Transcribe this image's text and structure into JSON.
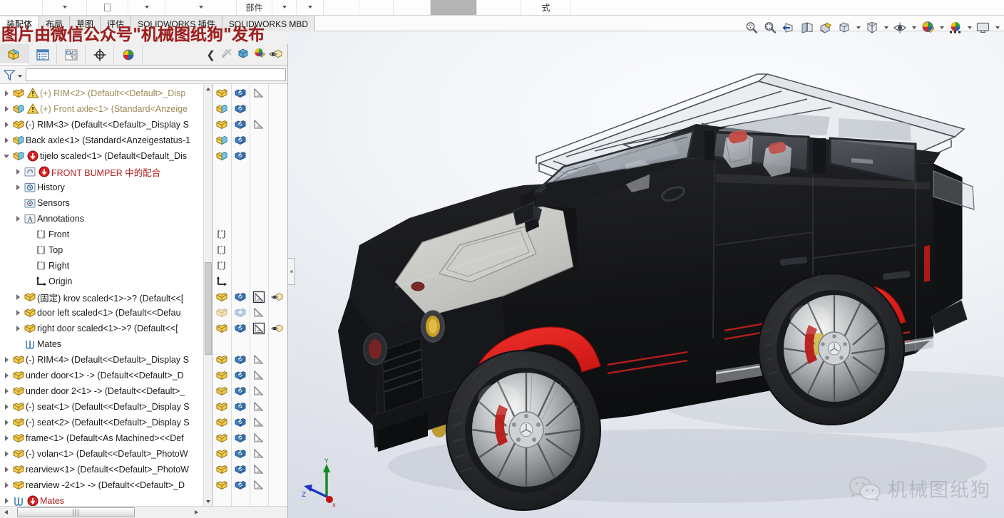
{
  "app": {
    "name": "SOLIDWORKS",
    "document_type_label": "部件",
    "formula_label": "式"
  },
  "ribbon": {
    "tabs": [
      {
        "label": "装配体",
        "active": true
      },
      {
        "label": "布局",
        "active": false
      },
      {
        "label": "草图",
        "active": false
      },
      {
        "label": "评估",
        "active": false
      },
      {
        "label": "SOLIDWORKS 插件",
        "active": false
      },
      {
        "label": "SOLIDWORKS MBD",
        "active": false
      }
    ]
  },
  "watermarks": {
    "top_red_text": "图片由微信公众号\"机械图纸狗\"发布",
    "bottom_right_text": "机械图纸狗",
    "bottom_right_icon": "wechat-icon",
    "top_red_color": "#9c2020",
    "bottom_right_color": "#8d9099"
  },
  "view_toolbar": {
    "items": [
      {
        "name": "zoom-to-fit-icon",
        "caret": false
      },
      {
        "name": "zoom-to-area-icon",
        "caret": false
      },
      {
        "name": "previous-view-icon",
        "caret": false
      },
      {
        "name": "section-view-icon",
        "caret": false
      },
      {
        "name": "view-orientation-icon",
        "caret": false
      },
      {
        "name": "display-style-icon",
        "caret": true
      },
      {
        "name": "hide-show-items-icon",
        "caret": true
      },
      {
        "name": "edit-appearance-icon",
        "caret": true
      },
      {
        "name": "apply-scene-icon",
        "caret": true
      },
      {
        "name": "view-settings-icon",
        "caret": true
      }
    ]
  },
  "manager_tabs": {
    "items": [
      {
        "name": "feature-manager-tab",
        "icon": "assembly-tree-icon",
        "active": true
      },
      {
        "name": "property-manager-tab",
        "icon": "property-list-icon",
        "active": false
      },
      {
        "name": "configuration-manager-tab",
        "icon": "configuration-icon",
        "active": false
      },
      {
        "name": "dimxpert-manager-tab",
        "icon": "dimxpert-target-icon",
        "active": false
      },
      {
        "name": "display-manager-tab",
        "icon": "display-palette-icon",
        "active": false
      }
    ],
    "right_icons": [
      {
        "name": "collapse-panel-chevron-icon"
      },
      {
        "name": "hide-all-types-icon"
      },
      {
        "name": "view-orientation-cube-icon"
      },
      {
        "name": "appearances-icon"
      },
      {
        "name": "display-pane-eye-icon"
      }
    ]
  },
  "filter": {
    "icon": "filter-funnel-icon",
    "value": "",
    "placeholder": ""
  },
  "tree": {
    "rows": [
      {
        "indent": 0,
        "toggle": "right",
        "icon": "component-yellow",
        "warn": true,
        "label": "(+) RIM<2>  (Default<<Default>_Disp",
        "style": "dim"
      },
      {
        "indent": 0,
        "toggle": "right",
        "icon": "component-blue",
        "warn": true,
        "label": "(+) Front axle<1>  (Standard<Anzeige",
        "style": "dim"
      },
      {
        "indent": 0,
        "toggle": "right",
        "icon": "component-yellow",
        "warn": false,
        "label": "(-) RIM<3>  (Default<<Default>_Display S",
        "style": "normal"
      },
      {
        "indent": 0,
        "toggle": "right",
        "icon": "component-blue",
        "warn": false,
        "label": "Back axle<1>  (Standard<Anzeigestatus-1",
        "style": "normal"
      },
      {
        "indent": 0,
        "toggle": "down",
        "icon": "component-blue",
        "err": true,
        "label": "tijelo scaled<1>  (Default<Default_Dis",
        "style": "normal"
      },
      {
        "indent": 1,
        "toggle": "right",
        "icon": "mate-folder-icon",
        "err": true,
        "label": "FRONT BUMPER 中的配合",
        "style": "red"
      },
      {
        "indent": 1,
        "toggle": "right",
        "icon": "history-folder-icon",
        "label": "History",
        "style": "normal"
      },
      {
        "indent": 1,
        "toggle": "none",
        "icon": "sensors-folder-icon",
        "label": "Sensors",
        "style": "normal"
      },
      {
        "indent": 1,
        "toggle": "right",
        "icon": "annotations-folder-icon",
        "label": "Annotations",
        "style": "normal"
      },
      {
        "indent": 2,
        "toggle": "none",
        "icon": "plane-icon",
        "label": "Front",
        "style": "normal"
      },
      {
        "indent": 2,
        "toggle": "none",
        "icon": "plane-icon",
        "label": "Top",
        "style": "normal"
      },
      {
        "indent": 2,
        "toggle": "none",
        "icon": "plane-icon",
        "label": "Right",
        "style": "normal"
      },
      {
        "indent": 2,
        "toggle": "none",
        "icon": "origin-icon",
        "label": "Origin",
        "style": "normal"
      },
      {
        "indent": 1,
        "toggle": "right",
        "icon": "component-yellow",
        "label": "(固定) krov scaled<1>->?  (Default<<[",
        "style": "normal"
      },
      {
        "indent": 1,
        "toggle": "right",
        "icon": "component-yellow",
        "label": "door left scaled<1>  (Default<<Defau",
        "style": "normal"
      },
      {
        "indent": 1,
        "toggle": "right",
        "icon": "component-yellow",
        "label": "right door scaled<1>->?  (Default<<[",
        "style": "normal"
      },
      {
        "indent": 1,
        "toggle": "none",
        "icon": "mates-clip-icon",
        "label": "Mates",
        "style": "normal"
      },
      {
        "indent": 0,
        "toggle": "right",
        "icon": "component-yellow",
        "label": "(-) RIM<4>  (Default<<Default>_Display S",
        "style": "normal"
      },
      {
        "indent": 0,
        "toggle": "right",
        "icon": "component-yellow",
        "label": "under door<1> ->  (Default<<Default>_D",
        "style": "normal"
      },
      {
        "indent": 0,
        "toggle": "right",
        "icon": "component-yellow",
        "label": "under door 2<1> ->  (Default<<Default>_",
        "style": "normal"
      },
      {
        "indent": 0,
        "toggle": "right",
        "icon": "component-yellow",
        "label": "(-) seat<1>  (Default<<Default>_Display S",
        "style": "normal"
      },
      {
        "indent": 0,
        "toggle": "right",
        "icon": "component-yellow",
        "label": "(-) seat<2>  (Default<<Default>_Display S",
        "style": "normal"
      },
      {
        "indent": 0,
        "toggle": "right",
        "icon": "component-yellow",
        "label": "frame<1>  (Default<As Machined><<Def",
        "style": "normal"
      },
      {
        "indent": 0,
        "toggle": "right",
        "icon": "component-yellow",
        "label": "(-) volan<1>  (Default<<Default>_PhotoW",
        "style": "normal"
      },
      {
        "indent": 0,
        "toggle": "right",
        "icon": "component-yellow",
        "label": "rearview<1>  (Default<<Default>_PhotoW",
        "style": "normal"
      },
      {
        "indent": 0,
        "toggle": "right",
        "icon": "component-yellow",
        "label": "rearview -2<1> ->  (Default<<Default>_D",
        "style": "normal"
      },
      {
        "indent": 0,
        "toggle": "right",
        "icon": "mates-clip-icon",
        "err": true,
        "label": "Mates",
        "style": "red"
      }
    ]
  },
  "display_pane": {
    "column_headers": [
      "component",
      "display-mode",
      "appearance",
      "transparency"
    ],
    "rows": [
      {
        "row": 0,
        "cells": [
          "component-yellow",
          "display-state-blue",
          "appearance-hatch",
          ""
        ]
      },
      {
        "row": 1,
        "cells": [
          "component-blue",
          "display-state-blue",
          "",
          ""
        ]
      },
      {
        "row": 2,
        "cells": [
          "component-yellow",
          "display-state-blue",
          "appearance-hatch",
          ""
        ]
      },
      {
        "row": 3,
        "cells": [
          "component-blue",
          "display-state-blue",
          "",
          ""
        ]
      },
      {
        "row": 4,
        "cells": [
          "component-blue",
          "display-state-blue",
          "",
          ""
        ]
      },
      {
        "row": 9,
        "cells": [
          "plane-icon",
          "",
          "",
          ""
        ]
      },
      {
        "row": 10,
        "cells": [
          "plane-icon",
          "",
          "",
          ""
        ]
      },
      {
        "row": 11,
        "cells": [
          "plane-icon",
          "",
          "",
          ""
        ]
      },
      {
        "row": 12,
        "cells": [
          "origin-icon",
          "",
          "",
          ""
        ]
      },
      {
        "row": 13,
        "cells": [
          "component-yellow",
          "display-state-blue",
          "appearance-boxed",
          "transparency-eye"
        ]
      },
      {
        "row": 14,
        "cells": [
          "component-pale",
          "display-state-pale",
          "appearance-hatch",
          ""
        ]
      },
      {
        "row": 15,
        "cells": [
          "component-yellow",
          "display-state-blue",
          "appearance-boxed",
          "transparency-eye"
        ]
      },
      {
        "row": 17,
        "cells": [
          "component-yellow",
          "display-state-blue",
          "appearance-hatch",
          ""
        ]
      },
      {
        "row": 18,
        "cells": [
          "component-yellow",
          "display-state-blue",
          "appearance-hatch",
          ""
        ]
      },
      {
        "row": 19,
        "cells": [
          "component-yellow",
          "display-state-blue",
          "appearance-hatch",
          ""
        ]
      },
      {
        "row": 20,
        "cells": [
          "component-yellow",
          "display-state-blue",
          "appearance-hatch",
          ""
        ]
      },
      {
        "row": 21,
        "cells": [
          "component-yellow",
          "display-state-blue",
          "appearance-hatch",
          ""
        ]
      },
      {
        "row": 22,
        "cells": [
          "component-yellow",
          "display-state-blue",
          "appearance-hatch",
          ""
        ]
      },
      {
        "row": 23,
        "cells": [
          "component-yellow",
          "display-state-blue",
          "appearance-hatch",
          ""
        ]
      },
      {
        "row": 24,
        "cells": [
          "component-yellow",
          "display-state-blue",
          "appearance-hatch",
          ""
        ]
      },
      {
        "row": 25,
        "cells": [
          "component-yellow",
          "display-state-blue",
          "appearance-hatch",
          ""
        ]
      }
    ]
  },
  "viewport": {
    "model_name": "Mercedes-Benz G-Class assembly",
    "triad": {
      "x_label": "x",
      "y_label": "Y",
      "z_label": "Z",
      "x_color": "#c01414",
      "y_color": "#0e8a1e",
      "z_color": "#1c34c8"
    },
    "body_color": "#17181a",
    "accent_color": "#e01b1b",
    "hood_color": "#c9c9c6",
    "glass_color": "#a9aeb6",
    "background_top": "#fbfcfe",
    "background_bottom": "#d8dce5"
  },
  "scrollbars": {
    "vertical_thumb_label": "",
    "horizontal_thumb_label": "|||"
  }
}
